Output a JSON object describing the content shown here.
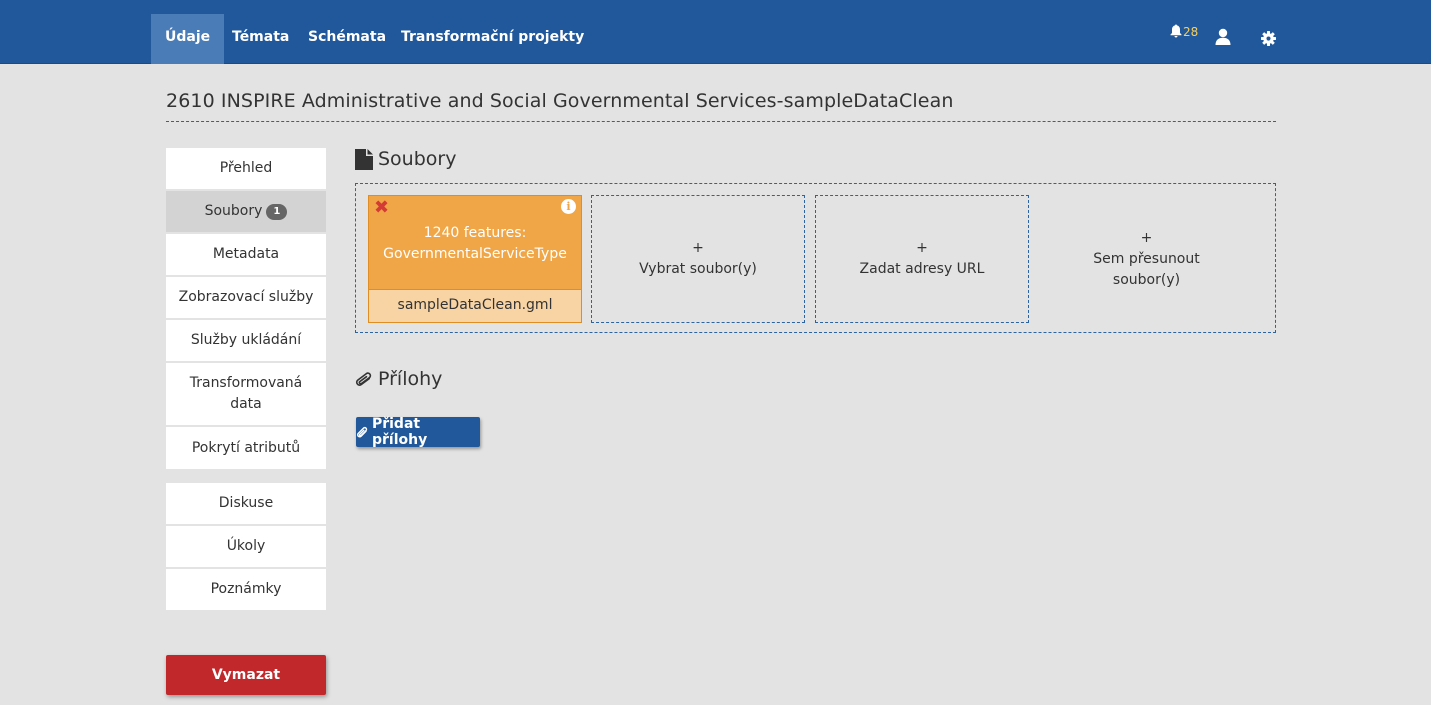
{
  "nav": {
    "items": [
      {
        "label": "Údaje",
        "active": true
      },
      {
        "label": "Témata",
        "active": false
      },
      {
        "label": "Schémata",
        "active": false
      },
      {
        "label": "Transformační projekty",
        "active": false
      }
    ],
    "notifications_count": "28",
    "icons": [
      "bell-icon",
      "user-icon",
      "gear-icon"
    ]
  },
  "page": {
    "title": "2610 INSPIRE Administrative and Social Governmental Services-sampleDataClean"
  },
  "sidebar": {
    "items": [
      {
        "label": "Přehled"
      },
      {
        "label": "Soubory",
        "badge": "1",
        "active": true
      },
      {
        "label": "Metadata"
      },
      {
        "label": "Zobrazovací služby"
      },
      {
        "label": "Služby ukládání"
      },
      {
        "label": "Transformovaná data"
      },
      {
        "label": "Pokrytí atributů"
      }
    ],
    "secondary": [
      {
        "label": "Diskuse"
      },
      {
        "label": "Úkoly"
      },
      {
        "label": "Poznámky"
      }
    ],
    "delete_label": "Vymazat"
  },
  "files": {
    "heading": "Soubory",
    "card": {
      "features": "1240 features:",
      "type": "GovernmentalServiceType",
      "filename": "sampleDataClean.gml",
      "colors": {
        "card": "#f0a646",
        "footer": "#f8d4a5",
        "remove": "#d43b36"
      }
    },
    "select_plus": "+",
    "select_label": "Vybrat soubor(y)",
    "url_plus": "+",
    "url_label": "Zadat adresy URL",
    "drop_plus": "+",
    "drop_label_1": "Sem přesunout",
    "drop_label_2": "soubor(y)"
  },
  "attachments": {
    "heading": "Přílohy",
    "add_label": "Přidat přílohy"
  },
  "colors": {
    "primary": "#21589b",
    "active_nav": "#4a7cb8",
    "danger": "#c0282b",
    "background": "#e3e3e3"
  }
}
